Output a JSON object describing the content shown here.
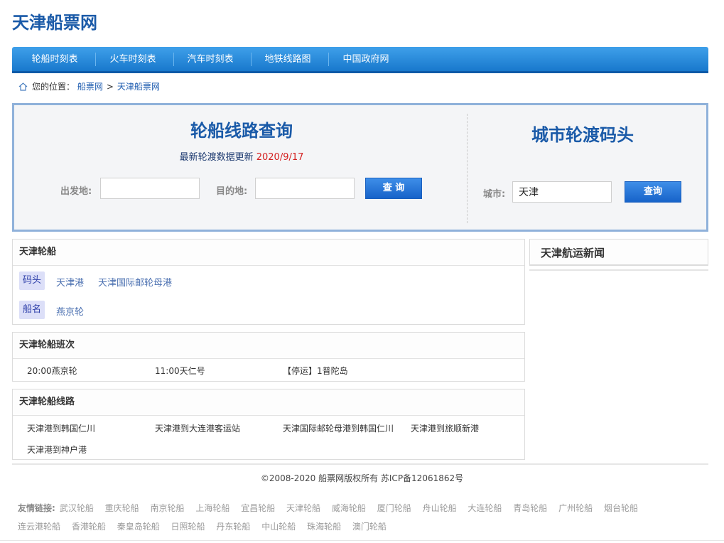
{
  "site": {
    "logo": "天津船票网"
  },
  "nav": {
    "items": [
      "轮船时刻表",
      "火车时刻表",
      "汽车时刻表",
      "地铁线路图",
      "中国政府网"
    ]
  },
  "breadcrumb": {
    "prefix": "您的位置：",
    "items": [
      "船票网",
      "天津船票网"
    ],
    "separator": ">"
  },
  "route_search": {
    "title": "轮船线路查询",
    "update_text": "最新轮渡数据更新",
    "update_date": "2020/9/17",
    "from_label": "出发地:",
    "from_value": "",
    "to_label": "目的地:",
    "to_value": "",
    "button": "查 询"
  },
  "city_search": {
    "title": "城市轮渡码头",
    "city_label": "城市:",
    "city_value": "天津",
    "button": "查询"
  },
  "ships_panel": {
    "title": "天津轮船",
    "pier_tag": "码头",
    "piers": [
      "天津港",
      "天津国际邮轮母港"
    ],
    "ship_tag": "船名",
    "ships": [
      "燕京轮"
    ]
  },
  "schedule_panel": {
    "title": "天津轮船班次",
    "items": [
      "20:00燕京轮",
      "11:00天仁号",
      "【停运】1普陀岛"
    ]
  },
  "routes_panel": {
    "title": "天津轮船线路",
    "items": [
      "天津港到韩国仁川",
      "天津港到大连港客运站",
      "天津国际邮轮母港到韩国仁川",
      "天津港到旅顺新港",
      "天津港到神户港"
    ]
  },
  "news": {
    "title": "天津航运新闻"
  },
  "footer": {
    "copyright": "©2008-2020 船票网版权所有 苏ICP备12061862号",
    "friends_label": "友情链接:",
    "friends": [
      "武汉轮船",
      "重庆轮船",
      "南京轮船",
      "上海轮船",
      "宜昌轮船",
      "天津轮船",
      "威海轮船",
      "厦门轮船",
      "舟山轮船",
      "大连轮船",
      "青岛轮船",
      "广州轮船",
      "烟台轮船",
      "连云港轮船",
      "香港轮船",
      "秦皇岛轮船",
      "日照轮船",
      "丹东轮船",
      "中山轮船",
      "珠海轮船",
      "澳门轮船"
    ]
  },
  "colors": {
    "brand": "#1a5aa8",
    "nav": "#1878cc",
    "date": "#d42020",
    "tag_bg": "#dcdff8"
  }
}
